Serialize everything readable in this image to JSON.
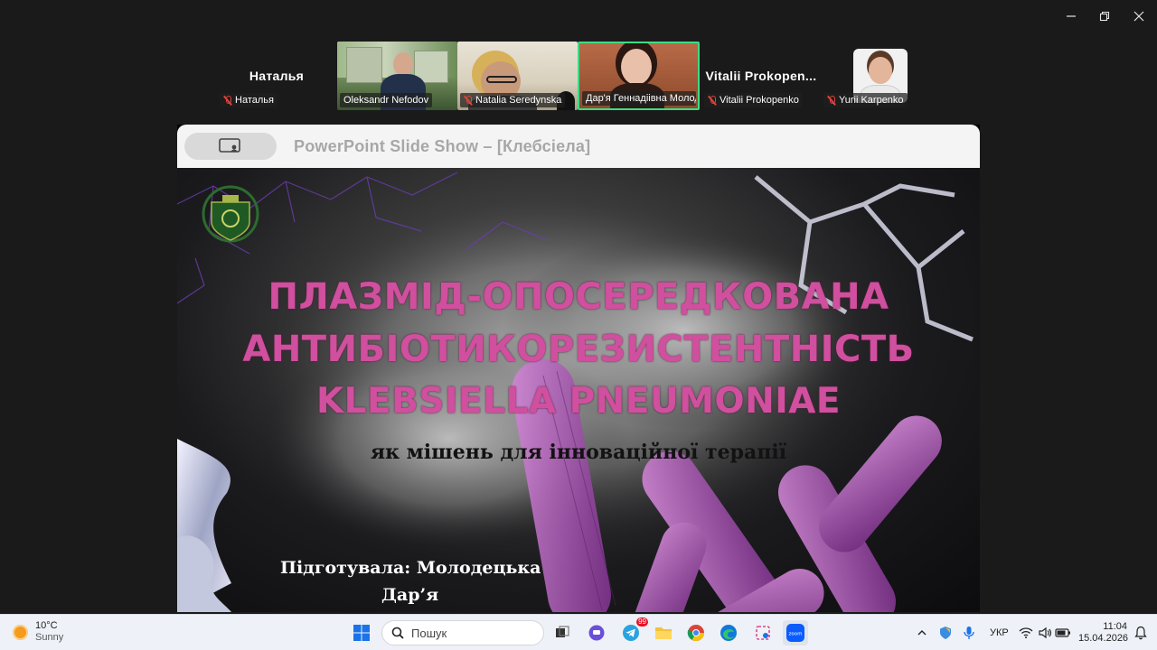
{
  "participants": [
    {
      "name_large": "Наталья",
      "label": "Наталья",
      "muted": true
    },
    {
      "name_large": "",
      "label": "Oleksandr Nefodov",
      "muted": false
    },
    {
      "name_large": "",
      "label": "Natalia Seredynska",
      "muted": true
    },
    {
      "name_large": "",
      "label": "Дар'я Геннадіівна Молод...",
      "muted": false
    },
    {
      "name_large": "Vitalii  Prokopen...",
      "label": "Vitalii Prokopenko",
      "muted": true
    },
    {
      "name_large": "",
      "label": "Yurii Karpenko",
      "muted": true
    }
  ],
  "share": {
    "window_title": "PowerPoint Slide Show  –  [Клебсіела]"
  },
  "slide": {
    "title_line1": "ПЛАЗМІД-ОПОСЕРЕДКОВАНА",
    "title_line2": "АНТИБІОТИКОРЕЗИСТЕНТНІСТЬ",
    "title_line3": "KLEBSIELLA PNEUMONIAE",
    "subtitle": "як мішень для інноваційної терапії",
    "author_line1": "Підготувала: Молодецька",
    "author_line2": "Дар’я"
  },
  "taskbar": {
    "weather_temp": "10°C",
    "weather_desc": "Sunny",
    "search_placeholder": "Пошук",
    "telegram_badge": "99",
    "language": "УКР",
    "time": "11:04",
    "date": "15.04.2026"
  },
  "colors": {
    "title_pink": "#d04f9e",
    "active_speaker": "#3ddc84",
    "muted_red": "#e0423a"
  }
}
